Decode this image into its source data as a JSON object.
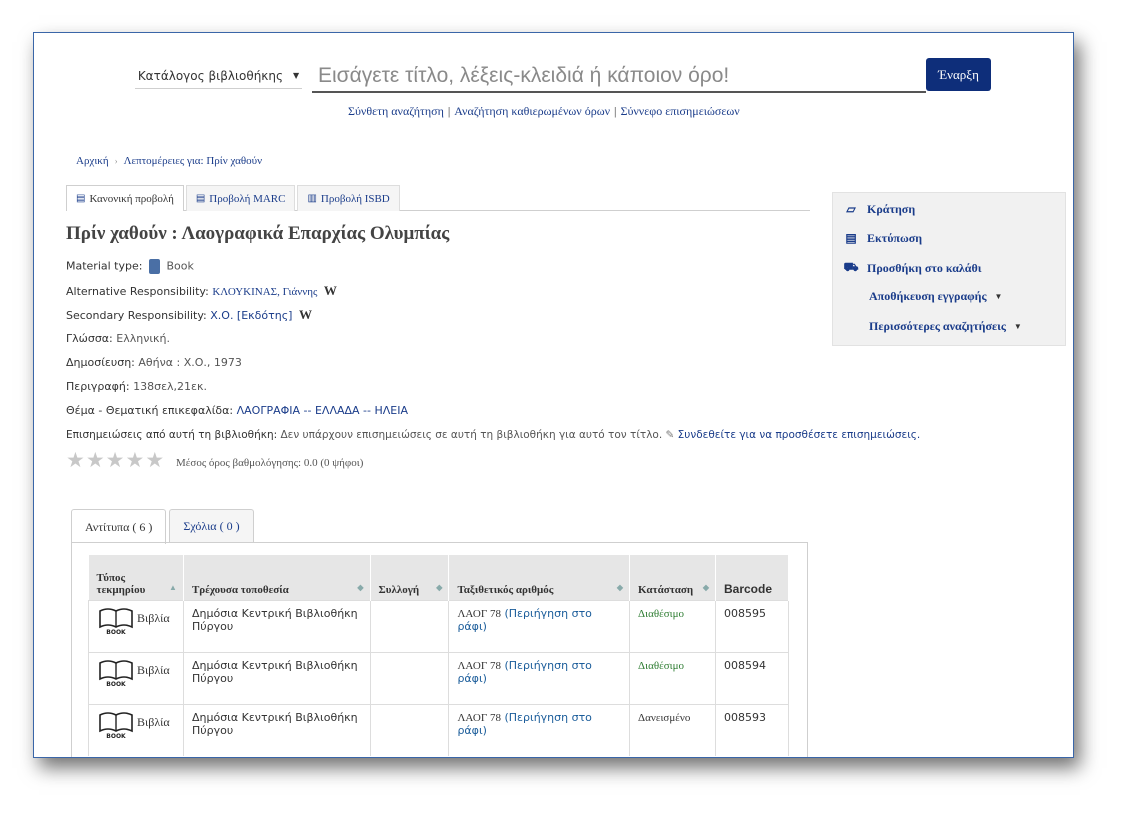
{
  "search": {
    "catalog_label": "Κατάλογος βιβλιοθήκης",
    "placeholder": "Εισάγετε τίτλο, λέξεις-κλειδιά ή κάποιον όρο!",
    "go_label": "Έναρξη"
  },
  "sublinks": {
    "advanced": "Σύνθετη αναζήτηση",
    "authorities": "Αναζήτηση καθιερωμένων όρων",
    "tag_cloud": "Σύννεφο επισημειώσεων"
  },
  "breadcrumb": {
    "home": "Αρχική",
    "current": "Λεπτομέρειες για: Πρίν χαθούν"
  },
  "view_tabs": [
    "Κανονική προβολή",
    "Προβολή MARC",
    "Προβολή ISBD"
  ],
  "record": {
    "title": "Πρίν χαθούν : Λαογραφικά Επαρχίας Ολυμπίας",
    "material_label": "Material type:",
    "material_value": "Book",
    "alt_resp_label": "Alternative Responsibility:",
    "alt_resp_value": "ΚΛΟΥΚΙΝΑΣ, Γιάννης",
    "sec_resp_label": "Secondary Responsibility:",
    "sec_resp_value": "Χ.Ο. [Εκδότης]",
    "wiki": "W",
    "lang_label": "Γλώσσα:",
    "lang_value": "Ελληνική.",
    "pub_label": "Δημοσίευση:",
    "pub_value": "Αθήνα : Χ.Ο., 1973",
    "desc_label": "Περιγραφή:",
    "desc_value": "138σελ,21εκ.",
    "subject_label": "Θέμα - Θεματική επικεφαλίδα:",
    "subject_value": "ΛΑΟΓΡΑΦΙΑ -- ΕΛΛΑΔΑ -- ΗΛΕΙΑ",
    "tags_label": "Επισημειώσεις από αυτή τη βιβλιοθήκη:",
    "tags_value": "Δεν υπάρχουν επισημειώσεις σε αυτή τη βιβλιοθήκη για αυτό τον τίτλο.",
    "tags_login": "Συνδεθείτε για να προσθέσετε επισημειώσεις.",
    "rating_value": 0,
    "rating_text": "Μέσος όρος βαθμολόγησης: 0.0 (0 ψήφοι)"
  },
  "holdings_tabs": {
    "copies": "Αντίτυπα ( 6 )",
    "comments": "Σχόλια ( 0 )"
  },
  "holdings": {
    "headers": [
      "Τύπος τεκμηρίου",
      "Τρέχουσα τοποθεσία",
      "Συλλογή",
      "Ταξιθετικός αριθμός",
      "Κατάσταση",
      "Barcode"
    ],
    "rows": [
      {
        "type": "Βιβλία",
        "book_label": "BOOK",
        "location": "Δημόσια Κεντρική Βιβλιοθήκη Πύργου",
        "collection": "",
        "call": "ΛΑΟΓ 78",
        "shelf": "(Περιήγηση στο ράφι)",
        "status": "Διαθέσιμο",
        "barcode": "008595"
      },
      {
        "type": "Βιβλία",
        "book_label": "BOOK",
        "location": "Δημόσια Κεντρική Βιβλιοθήκη Πύργου",
        "collection": "",
        "call": "ΛΑΟΓ 78",
        "shelf": "(Περιήγηση στο ράφι)",
        "status": "Διαθέσιμο",
        "barcode": "008594"
      },
      {
        "type": "Βιβλία",
        "book_label": "BOOK",
        "location": "Δημόσια Κεντρική Βιβλιοθήκη Πύργου",
        "collection": "",
        "call": "ΛΑΟΓ 78",
        "shelf": "(Περιήγηση στο ράφι)",
        "status": "Δανεισμένο",
        "barcode": "008593"
      }
    ]
  },
  "actions": {
    "hold": "Κράτηση",
    "print": "Εκτύπωση",
    "cart": "Προσθήκη στο καλάθι",
    "save": "Αποθήκευση εγγραφής",
    "more": "Περισσότερες αναζητήσεις"
  },
  "colors": {
    "accent": "#0e2e7a",
    "link": "#1a3c8a",
    "available": "#2e7d32"
  }
}
